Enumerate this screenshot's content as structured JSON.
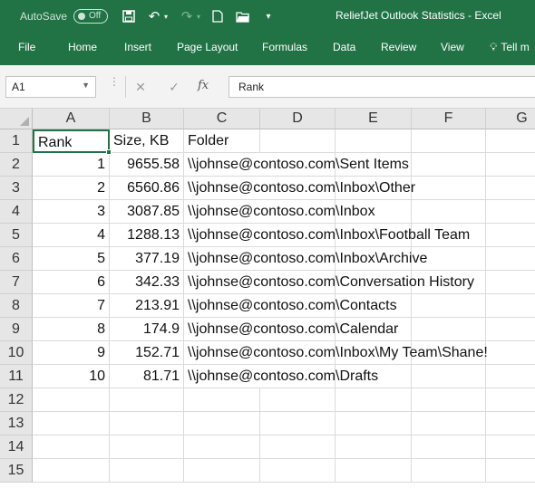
{
  "titlebar": {
    "autosave_label": "AutoSave",
    "autosave_state": "Off",
    "document_title": "ReliefJet Outlook Statistics  -  Excel"
  },
  "ribbon": {
    "tabs": [
      "File",
      "Home",
      "Insert",
      "Page Layout",
      "Formulas",
      "Data",
      "Review",
      "View"
    ],
    "tell_me": "Tell m"
  },
  "formula_bar": {
    "name_box": "A1",
    "formula": "Rank"
  },
  "columns": [
    "A",
    "B",
    "C",
    "D",
    "E",
    "F",
    "G"
  ],
  "rows": [
    "1",
    "2",
    "3",
    "4",
    "5",
    "6",
    "7",
    "8",
    "9",
    "10",
    "11",
    "12",
    "13",
    "14",
    "15"
  ],
  "sheet": {
    "headers": [
      "Rank",
      "Size, KB",
      "Folder"
    ],
    "data": [
      [
        "1",
        "9655.58",
        "\\\\johnse@contoso.com\\Sent Items"
      ],
      [
        "2",
        "6560.86",
        "\\\\johnse@contoso.com\\Inbox\\Other"
      ],
      [
        "3",
        "3087.85",
        "\\\\johnse@contoso.com\\Inbox"
      ],
      [
        "4",
        "1288.13",
        "\\\\johnse@contoso.com\\Inbox\\Football Team"
      ],
      [
        "5",
        "377.19",
        "\\\\johnse@contoso.com\\Inbox\\Archive"
      ],
      [
        "6",
        "342.33",
        "\\\\johnse@contoso.com\\Conversation History"
      ],
      [
        "7",
        "213.91",
        "\\\\johnse@contoso.com\\Contacts"
      ],
      [
        "8",
        "174.9",
        "\\\\johnse@contoso.com\\Calendar"
      ],
      [
        "9",
        "152.71",
        "\\\\johnse@contoso.com\\Inbox\\My Team\\Shane!"
      ],
      [
        "10",
        "81.71",
        "\\\\johnse@contoso.com\\Drafts"
      ]
    ]
  },
  "colors": {
    "brand_green": "#217346"
  }
}
